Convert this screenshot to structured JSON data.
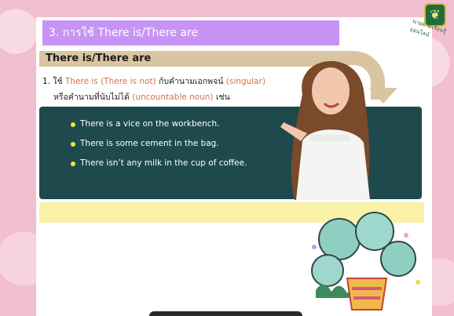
{
  "header": {
    "title": "3. การใช้ There is/There are",
    "logo_caption": "นายตามเรียนรู้ออนไลน์"
  },
  "section": {
    "heading": "There is/There are"
  },
  "rule": {
    "line1_prefix": "1. ใช้ ",
    "line1_hl1": "There is (There is not)",
    "line1_mid": " กับคำนามเอกพจน์ ",
    "line1_hl2": "(singular)",
    "line2_prefix": "หรือคำนามที่นับไม่ได้ ",
    "line2_hl": "(uncountable noun)",
    "line2_suffix": " เช่น"
  },
  "examples": [
    "There is a vice on the workbench.",
    "There is some cement in the bag.",
    "There isn’t any milk in the cup of coffee."
  ],
  "colors": {
    "title_bar": "#c794f5",
    "section_bar": "#d9c6a1",
    "dark_box": "#1e4a4d",
    "bullet": "#f2e33a",
    "highlight": "#d9714a",
    "yellow_bar": "#f9f2a7",
    "background": "#f2bfd0"
  }
}
